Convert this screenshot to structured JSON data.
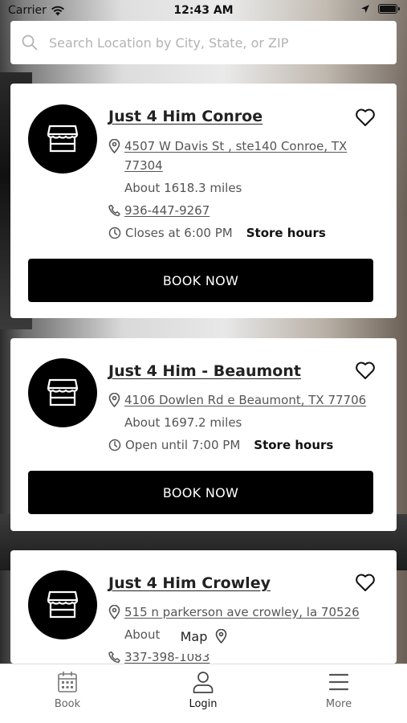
{
  "status_bar": {
    "carrier": "Carrier",
    "time": "12:43 AM"
  },
  "search": {
    "placeholder": "Search Location by City, State, or ZIP"
  },
  "stores": [
    {
      "name": "Just 4 Him Conroe",
      "address_line1": "4507 W Davis St , ste140 Conroe, TX",
      "address_line2": "77304",
      "distance": "About 1618.3 miles",
      "phone": "936-447-9267",
      "hours_status": "Closes at 6:00 PM",
      "store_hours_label": "Store hours",
      "book_label": "BOOK NOW"
    },
    {
      "name": "Just 4 Him - Beaumont",
      "address_line1": "4106 Dowlen Rd e Beaumont, TX 77706",
      "distance": "About 1697.2 miles",
      "hours_status": "Open until 7:00 PM",
      "store_hours_label": "Store hours",
      "book_label": "BOOK NOW"
    },
    {
      "name": "Just 4 Him Crowley",
      "address_line1": "515 n parkerson ave crowley, la 70526",
      "distance": "About",
      "phone": "337-398-1083"
    }
  ],
  "map_button": {
    "label": "Map"
  },
  "tabbar": {
    "items": [
      {
        "label": "Book",
        "icon": "calendar-icon"
      },
      {
        "label": "Login",
        "icon": "user-icon"
      },
      {
        "label": "More",
        "icon": "menu-icon"
      }
    ]
  },
  "colors": {
    "primary": "#000000",
    "card_bg": "#ffffff",
    "muted_text": "#555555"
  }
}
